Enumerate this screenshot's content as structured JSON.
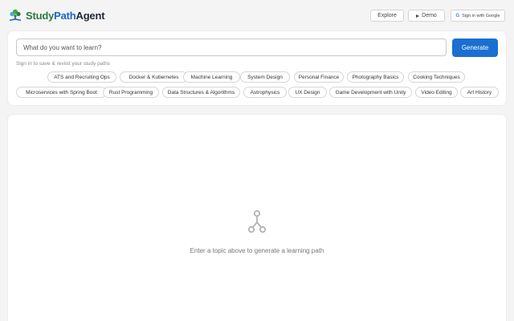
{
  "header": {
    "brand_study": "Study",
    "brand_path": "Path",
    "brand_agent": "Agent",
    "logo_icon": "tree-icon",
    "explore_label": "Explore",
    "demo_label": "Demo",
    "signin_label": "Sign in with Google",
    "google_glyph": "G"
  },
  "search": {
    "placeholder": "What do you want to learn?",
    "value": "",
    "generate_label": "Generate",
    "hint": "Sign in to save & revisit your study paths"
  },
  "topics": [
    "ATS and Recruiting Ops",
    "Docker & Kubernetes",
    "Machine Learning",
    "System Design",
    "Personal Finance",
    "Photography Basics",
    "Cooking Techniques",
    "Microservices with Spring Boot",
    "Rust Programming",
    "Data Structures & Algorithms",
    "Astrophysics",
    "UX Design",
    "Game Development with Unity",
    "Video Editing",
    "Art History"
  ],
  "main": {
    "empty_icon": "branch-icon",
    "empty_text": "Enter a topic above to generate a learning path"
  },
  "colors": {
    "accent": "#1a6fd1",
    "brand_green": "#2c7a3f",
    "brand_blue": "#1a66c9",
    "brand_dark": "#1f2a36"
  }
}
